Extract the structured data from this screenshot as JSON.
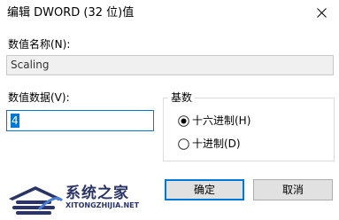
{
  "window": {
    "title": "编辑 DWORD (32 位)值"
  },
  "value_name": {
    "label": "数值名称(N):",
    "value": "Scaling"
  },
  "value_data": {
    "label": "数值数据(V):",
    "value": "4"
  },
  "base": {
    "title": "基数",
    "options": [
      {
        "label": "十六进制(H)",
        "selected": true
      },
      {
        "label": "十进制(D)",
        "selected": false
      }
    ]
  },
  "buttons": {
    "ok": "确定",
    "cancel": "取消"
  },
  "watermark": {
    "name": "系统之家",
    "url": "XITONGZHIJIA.NET"
  },
  "colors": {
    "accent": "#0078d7",
    "button_bg": "#e1e1e1",
    "readonly_bg": "#f0f0f0",
    "logo": "#2a3566"
  }
}
